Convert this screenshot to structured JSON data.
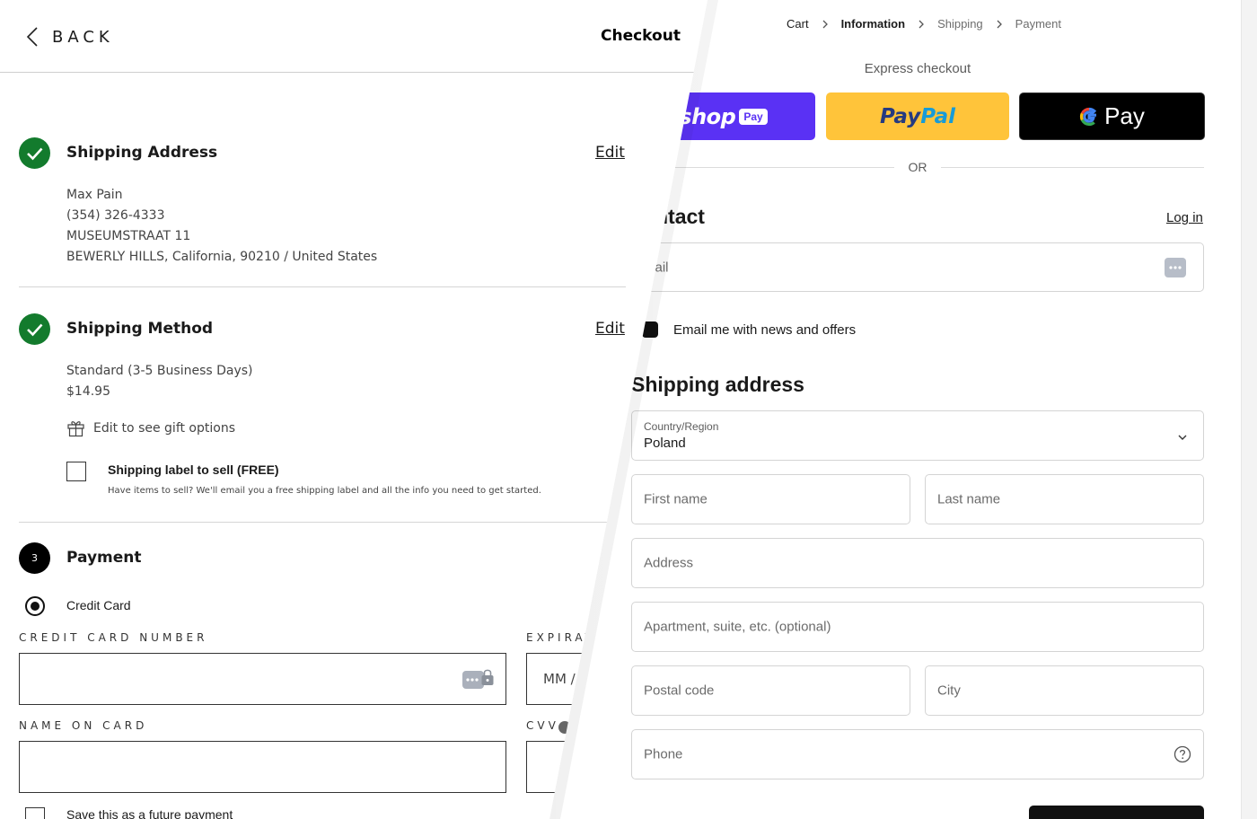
{
  "breadcrumb": {
    "items": [
      "Cart",
      "Information",
      "Shipping",
      "Payment"
    ]
  },
  "express": {
    "title": "Express checkout",
    "shop_pay": {
      "word": "shop",
      "badge": "Pay"
    },
    "paypal": {
      "part1": "Pay",
      "part2": "Pal"
    },
    "gpay": {
      "text": "Pay"
    },
    "or_label": "OR"
  },
  "contact": {
    "title": "ntact",
    "login_label": "Log in",
    "email_placeholder": "mail",
    "newsletter_label": "Email me with news and offers"
  },
  "shipping_address": {
    "title": "Shipping address",
    "country_label": "Country/Region",
    "country_value": "Poland",
    "first_name_placeholder": "First name",
    "last_name_placeholder": "Last name",
    "address_placeholder": "Address",
    "apartment_placeholder": "Apartment, suite, etc. (optional)",
    "postal_placeholder": "Postal code",
    "city_placeholder": "City",
    "phone_placeholder": "Phone"
  },
  "left": {
    "back_label": "BACK",
    "checkout_title": "Checkout",
    "shipping_address": {
      "title": "Shipping Address",
      "edit_label": "Edit",
      "lines": [
        "Max Pain",
        "(354) 326-4333",
        "MUSEUMSTRAAT 11",
        "BEWERLY HILLS, California, 90210 / United States"
      ]
    },
    "shipping_method": {
      "title": "Shipping Method",
      "edit_label": "Edit",
      "method": "Standard (3-5 Business Days)",
      "price": "$14.95",
      "gift_label": "Edit to see gift options",
      "label_title": "Shipping label to sell (FREE)",
      "label_note": "Have items to sell? We'll email you a free shipping label and all the info you need to get started."
    },
    "payment": {
      "step": "3",
      "title": "Payment",
      "credit_card_label": "Credit Card",
      "card_number_label": "CREDIT CARD NUMBER",
      "expiry_label": "EXPIRAT",
      "expiry_placeholder": "MM /",
      "name_label": "NAME ON CARD",
      "cvv_label": "CVV",
      "save_label": "Save this as a future payment"
    }
  }
}
